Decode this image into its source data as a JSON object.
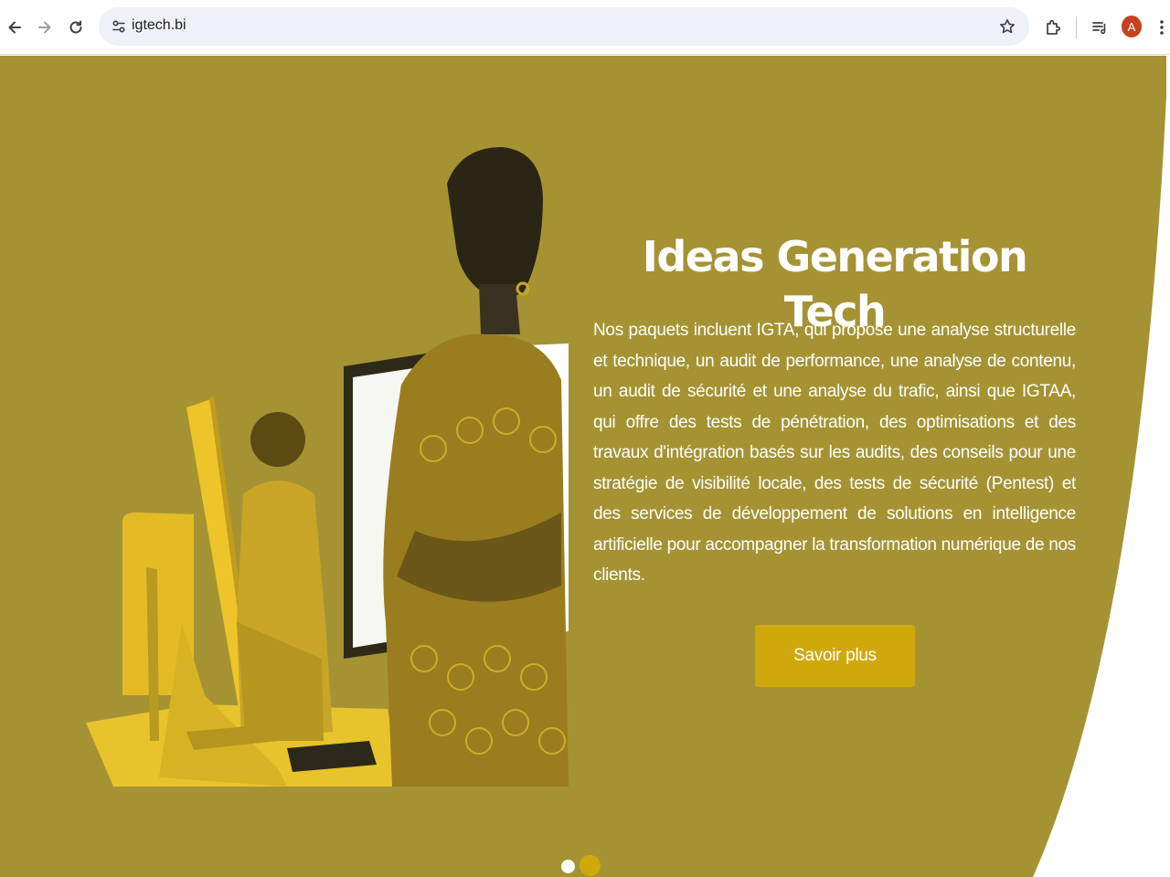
{
  "browser": {
    "url": "igtech.bi",
    "profile_initial": "A",
    "icons": [
      "back-icon",
      "forward-icon",
      "reload-icon",
      "site-info-icon",
      "bookmark-star-icon",
      "extensions-icon",
      "reading-list-icon",
      "menu-icon"
    ]
  },
  "hero": {
    "title": "Ideas Generation Tech",
    "description": "Nos paquets incluent IGTA, qui propose une analyse structurelle et technique, un audit de performance, une analyse de contenu, un audit de sécurité et une analyse du trafic, ainsi que IGTAA, qui offre des tests de pénétration, des optimisations et des travaux d'intégration basés sur les audits, des conseils pour une stratégie de visibilité locale, des tests de sécurité (Pentest) et des services de développement de solutions en intelligence artificielle pour accompagner la transformation numérique de nos clients.",
    "cta_label": "Savoir plus"
  },
  "colors": {
    "hero_background": "#a59333",
    "accent": "#cfa80c"
  }
}
